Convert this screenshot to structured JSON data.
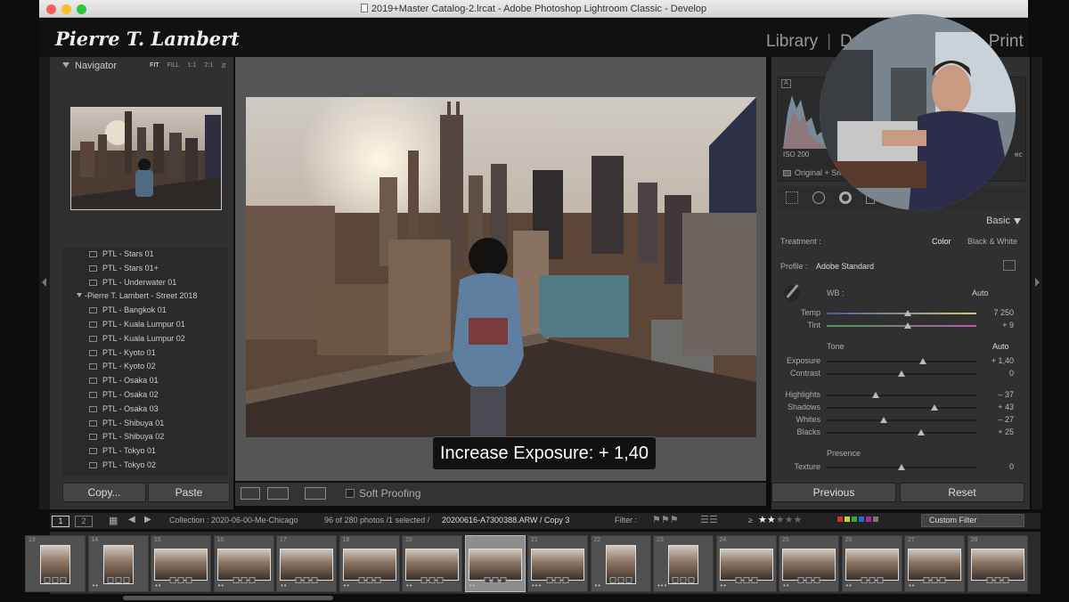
{
  "window": {
    "title": "2019+Master Catalog-2.lrcat - Adobe Photoshop Lightroom Classic - Develop"
  },
  "identity_plate": "Pierre T. Lambert",
  "modules": [
    {
      "label": "Library",
      "active": false
    },
    {
      "label": "|",
      "active": false
    },
    {
      "label": "D",
      "active": true
    },
    {
      "label": "|",
      "active": false
    },
    {
      "label": "Print",
      "active": false
    }
  ],
  "navigator": {
    "title": "Navigator",
    "zoom_options": [
      "FIT",
      "FILL",
      "1:1",
      "2:1"
    ],
    "active_zoom": "FIT"
  },
  "presets": [
    {
      "label": "PTL - Stars 01",
      "type": "preset"
    },
    {
      "label": "PTL - Stars 01+",
      "type": "preset"
    },
    {
      "label": "PTL - Underwater 01",
      "type": "preset"
    },
    {
      "label": "-Pierre T. Lambert - Street 2018",
      "type": "folder"
    },
    {
      "label": "PTL - Bangkok 01",
      "type": "preset"
    },
    {
      "label": "PTL - Kuala Lumpur 01",
      "type": "preset"
    },
    {
      "label": "PTL - Kuala Lumpur 02",
      "type": "preset"
    },
    {
      "label": "PTL - Kyoto 01",
      "type": "preset"
    },
    {
      "label": "PTL - Kyoto 02",
      "type": "preset"
    },
    {
      "label": "PTL - Osaka 01",
      "type": "preset"
    },
    {
      "label": "PTL - Osaka 02",
      "type": "preset"
    },
    {
      "label": "PTL - Osaka 03",
      "type": "preset"
    },
    {
      "label": "PTL - Shibuya 01",
      "type": "preset"
    },
    {
      "label": "PTL - Shibuya 02",
      "type": "preset"
    },
    {
      "label": "PTL - Tokyo 01",
      "type": "preset"
    },
    {
      "label": "PTL - Tokyo 02",
      "type": "preset"
    }
  ],
  "left_buttons": {
    "copy": "Copy...",
    "paste": "Paste"
  },
  "caption": "Increase Exposure: + 1,40",
  "toolbar": {
    "soft_proofing": "Soft Proofing"
  },
  "histogram": {
    "iso": "ISO 200",
    "original_label": "Original + Sm",
    "right_text": "ec",
    "a_label": "A"
  },
  "basic": {
    "title": "Basic",
    "treatment_label": "Treatment :",
    "treatment_color": "Color",
    "treatment_bw": "Black & White",
    "profile_label": "Profile :",
    "profile_value": "Adobe Standard",
    "wb_label": "WB :",
    "wb_value": "Auto",
    "tone_label": "Tone",
    "tone_auto": "Auto",
    "presence_label": "Presence"
  },
  "sliders": [
    {
      "label": "Temp",
      "value": "7 250",
      "pos": 0.54
    },
    {
      "label": "Tint",
      "value": "+ 9",
      "pos": 0.54
    },
    {
      "label": "Exposure",
      "value": "+ 1,40",
      "pos": 0.64
    },
    {
      "label": "Contrast",
      "value": "0",
      "pos": 0.5
    },
    {
      "label": "Highlights",
      "value": "– 37",
      "pos": 0.33
    },
    {
      "label": "Shadows",
      "value": "+ 43",
      "pos": 0.72
    },
    {
      "label": "Whites",
      "value": "– 27",
      "pos": 0.38
    },
    {
      "label": "Blacks",
      "value": "+ 25",
      "pos": 0.63
    },
    {
      "label": "Texture",
      "value": "0",
      "pos": 0.5
    }
  ],
  "right_buttons": {
    "previous": "Previous",
    "reset": "Reset"
  },
  "filmbar": {
    "monitor1": "1",
    "monitor2": "2",
    "collection": "Collection : 2020-06-00-Me-Chicago",
    "count": "96 of 280 photos /1 selected /",
    "filename": "20200616-A7300388.ARW / Copy 3",
    "filter_label": "Filter :",
    "rating_prefix": "≥",
    "stars_filled": 2,
    "stars_total": 5,
    "custom_filter": "Custom Filter"
  },
  "filmstrip": [
    {
      "num": "13",
      "orient": "portrait",
      "dots": "",
      "selected": false
    },
    {
      "num": "14",
      "orient": "portrait",
      "dots": "••",
      "selected": false
    },
    {
      "num": "15",
      "orient": "landscape",
      "dots": "••",
      "selected": false
    },
    {
      "num": "16",
      "orient": "landscape",
      "dots": "••",
      "selected": false
    },
    {
      "num": "17",
      "orient": "landscape",
      "dots": "••",
      "selected": false
    },
    {
      "num": "18",
      "orient": "landscape",
      "dots": "••",
      "selected": false
    },
    {
      "num": "19",
      "orient": "landscape",
      "dots": "••",
      "selected": false
    },
    {
      "num": "20",
      "orient": "landscape",
      "dots": "••",
      "selected": true
    },
    {
      "num": "21",
      "orient": "landscape",
      "dots": "•••",
      "selected": false
    },
    {
      "num": "22",
      "orient": "portrait",
      "dots": "••",
      "selected": false
    },
    {
      "num": "23",
      "orient": "portrait",
      "dots": "•••",
      "selected": false
    },
    {
      "num": "24",
      "orient": "landscape",
      "dots": "••",
      "selected": false
    },
    {
      "num": "25",
      "orient": "landscape",
      "dots": "••",
      "selected": false
    },
    {
      "num": "26",
      "orient": "landscape",
      "dots": "••",
      "selected": false
    },
    {
      "num": "27",
      "orient": "landscape",
      "dots": "••",
      "selected": false
    },
    {
      "num": "28",
      "orient": "landscape",
      "dots": "",
      "selected": false
    }
  ],
  "colors": {
    "accent": "#e8e8e8",
    "panel": "#303030",
    "center": "#555555",
    "filmstrip_selected": "#8d8d8d"
  }
}
